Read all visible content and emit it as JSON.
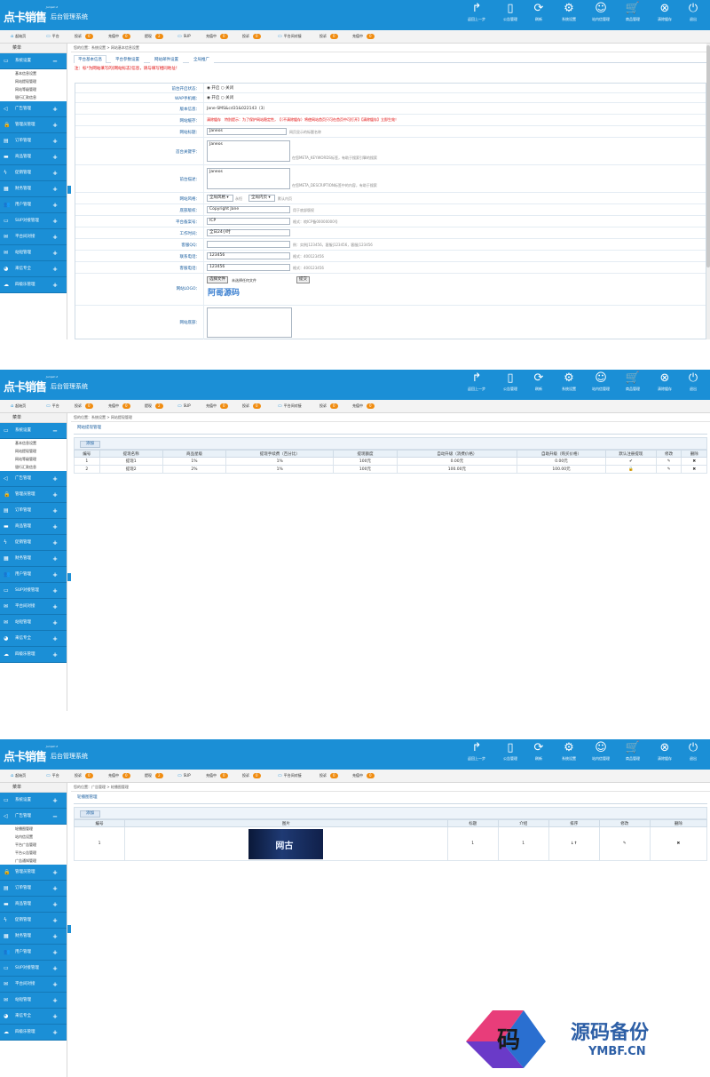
{
  "header": {
    "brand": "点卡销售",
    "brand_sup": "Jumpin 2",
    "subtitle": "后台管理系统",
    "tools": [
      {
        "label": "返回上一步",
        "icon": "redo-arrow-icon",
        "glyph": "↱"
      },
      {
        "label": "公告管理",
        "icon": "document-icon",
        "glyph": "▯"
      },
      {
        "label": "刷新",
        "icon": "refresh-icon",
        "glyph": "⟳"
      },
      {
        "label": "系统设置",
        "icon": "gear-icon",
        "glyph": "⚙"
      },
      {
        "label": "站内信管理",
        "icon": "smiley-icon",
        "glyph": "☺"
      },
      {
        "label": "商品管理",
        "icon": "cart-icon",
        "glyph": "🛒"
      },
      {
        "label": "清除缓存",
        "icon": "close-circle-icon",
        "glyph": "⊗"
      },
      {
        "label": "退出",
        "icon": "power-icon",
        "glyph": "⏻"
      }
    ]
  },
  "toolbar": {
    "home": "起始页",
    "items": [
      {
        "label": "平台",
        "icon": "monitor-icon"
      },
      {
        "label": "投诉",
        "badge": "0"
      },
      {
        "label": "充值中",
        "badge": "0"
      },
      {
        "label": "提现",
        "badge": "2"
      },
      {
        "label": "SUP",
        "icon": "truck-icon"
      },
      {
        "label": "充值中",
        "badge": "0"
      },
      {
        "label": "投诉",
        "badge": "0"
      },
      {
        "label": "平台间对接",
        "icon": "mail-icon"
      },
      {
        "label": "投诉",
        "badge": "0"
      },
      {
        "label": "充值中",
        "badge": "0"
      }
    ]
  },
  "sidebar": {
    "title": "菜单",
    "groups": [
      {
        "label": "系统设置",
        "icon": "monitor-icon"
      },
      {
        "label": "广告管理",
        "icon": "megaphone-icon"
      },
      {
        "label": "管理员管理",
        "icon": "lock-icon"
      },
      {
        "label": "订单管理",
        "icon": "clipboard-icon"
      },
      {
        "label": "商品管理",
        "icon": "folder-icon"
      },
      {
        "label": "促销管理",
        "icon": "bolt-icon"
      },
      {
        "label": "财务管理",
        "icon": "calculator-icon"
      },
      {
        "label": "用户管理",
        "icon": "users-icon"
      },
      {
        "label": "SUP对接管理",
        "icon": "truck-icon"
      },
      {
        "label": "平台间对接",
        "icon": "mail-icon"
      },
      {
        "label": "站短管理",
        "icon": "envelope-icon"
      },
      {
        "label": "来信专全",
        "icon": "pie-icon"
      },
      {
        "label": "四级乐管理",
        "icon": "cloud-icon"
      }
    ],
    "system_subs": [
      "基本信息设置",
      "网站提现管理",
      "网站等级管理",
      "银行汇款信息"
    ],
    "ad_subs": [
      "轮播图管理",
      "站内信设置",
      "平台广告管理",
      "平台公告管理",
      "广告通知管理"
    ]
  },
  "screen1": {
    "breadcrumb": "您的位置：系统设置 > 网站基本信息设置",
    "tabs": [
      "平台基本信息",
      "平台参数设置",
      "网站邮件设置",
      "全局推广"
    ],
    "notice": "注：标*为网站填写的[网站标志]信息，请与填写相同地址！",
    "fields": {
      "status_label": "前台开启状态：",
      "wap_label": "WAP手机端：",
      "radio_on": "开启",
      "radio_off": "关闭",
      "version_label": "版本信息：",
      "version_value": "Jane-SMS&cd31&022143（3）",
      "cache_label": "网站缓存：",
      "cache_note": "清除缓存　特别提示：为了保护网站稳定性，【（不清除缓存）将使网站首页只可在首页中可打开】【清除缓存】立即生效！",
      "name_label": "网站标题：",
      "name_value": "Janeos",
      "name_hint": "网页显示的标题名称",
      "keywords_label": "首台关键字：",
      "keywords_value": "Janeos",
      "keywords_hint": "在您META_KEYWORDS标签，有助于搜索引擎的搜索",
      "desc_label": "前台描述：",
      "desc_value": "Janeos",
      "desc_hint": "在您META_DESCRIPTION标签中的内容，有助于搜索",
      "style_label": "网站风格：",
      "style_value": "全局风格",
      "style_sep": "永恒",
      "style_value2": "全局内页",
      "style_hint": "默认内页",
      "copyright_label": "底部版权：",
      "copyright_value": "Copyright Jane",
      "copyright_hint": "用于底部版权",
      "icp_label": "平台备案号：",
      "icp_value": "ICP",
      "icp_hint": "格式：皖ICP备00000000号",
      "worktime_label": "工作时间：",
      "worktime_value": "全日24小时",
      "qq_label": "客服QQ：",
      "qq_hint": "例：实例|123456，客服|123456，客服|123456",
      "phone_label": "联系电话：",
      "phone_value": "123456",
      "phone_hint": "格式：400123456",
      "tel_label": "客服电话：",
      "tel_value": "123456",
      "tel_hint": "格式：400123456",
      "logo_label": "网站LOGO：",
      "file_button": "选择文件",
      "file_status": "未选择任何文件",
      "upload_button": "提交",
      "logo_text": "阿哥源码",
      "footer_label": "网站底部："
    }
  },
  "screen2": {
    "breadcrumb": "您的位置：系统设置 > 网站提现管理",
    "title": "网站提现管理",
    "add_label": "添加",
    "columns": [
      "编号",
      "提现名称",
      "商品星级",
      "提现手续费（百分比）",
      "提现额度",
      "自动升级（消费价格）",
      "自助升级（购买价格）",
      "默认注册提现",
      "修改",
      "删除"
    ],
    "rows": [
      {
        "id": "1",
        "name": "提现1",
        "stars": "1%",
        "fee": "1%",
        "limit": "100元",
        "auto": "0.00元",
        "self": "0.00元",
        "default": "✔"
      },
      {
        "id": "2",
        "name": "提现2",
        "stars": "2%",
        "fee": "1%",
        "limit": "100元",
        "auto": "100.00元",
        "self": "100.00元",
        "default": "🔒"
      }
    ]
  },
  "screen3": {
    "breadcrumb": "您的位置：广告管理 > 轮播图管理",
    "title": "轮播图管理",
    "add_label": "添加",
    "columns": [
      "编号",
      "图片",
      "标题",
      "介绍",
      "排序",
      "修改",
      "删除"
    ],
    "rows": [
      {
        "id": "1",
        "image_text": "网古",
        "title": "1",
        "intro": "1",
        "sort": "↓↑"
      }
    ]
  },
  "watermark": {
    "logo_char": "码",
    "title": "源码备份",
    "url": "YMBF.CN"
  },
  "colors": {
    "primary": "#1b8fd6",
    "badge": "#f08c10",
    "alert": "#e00000"
  }
}
